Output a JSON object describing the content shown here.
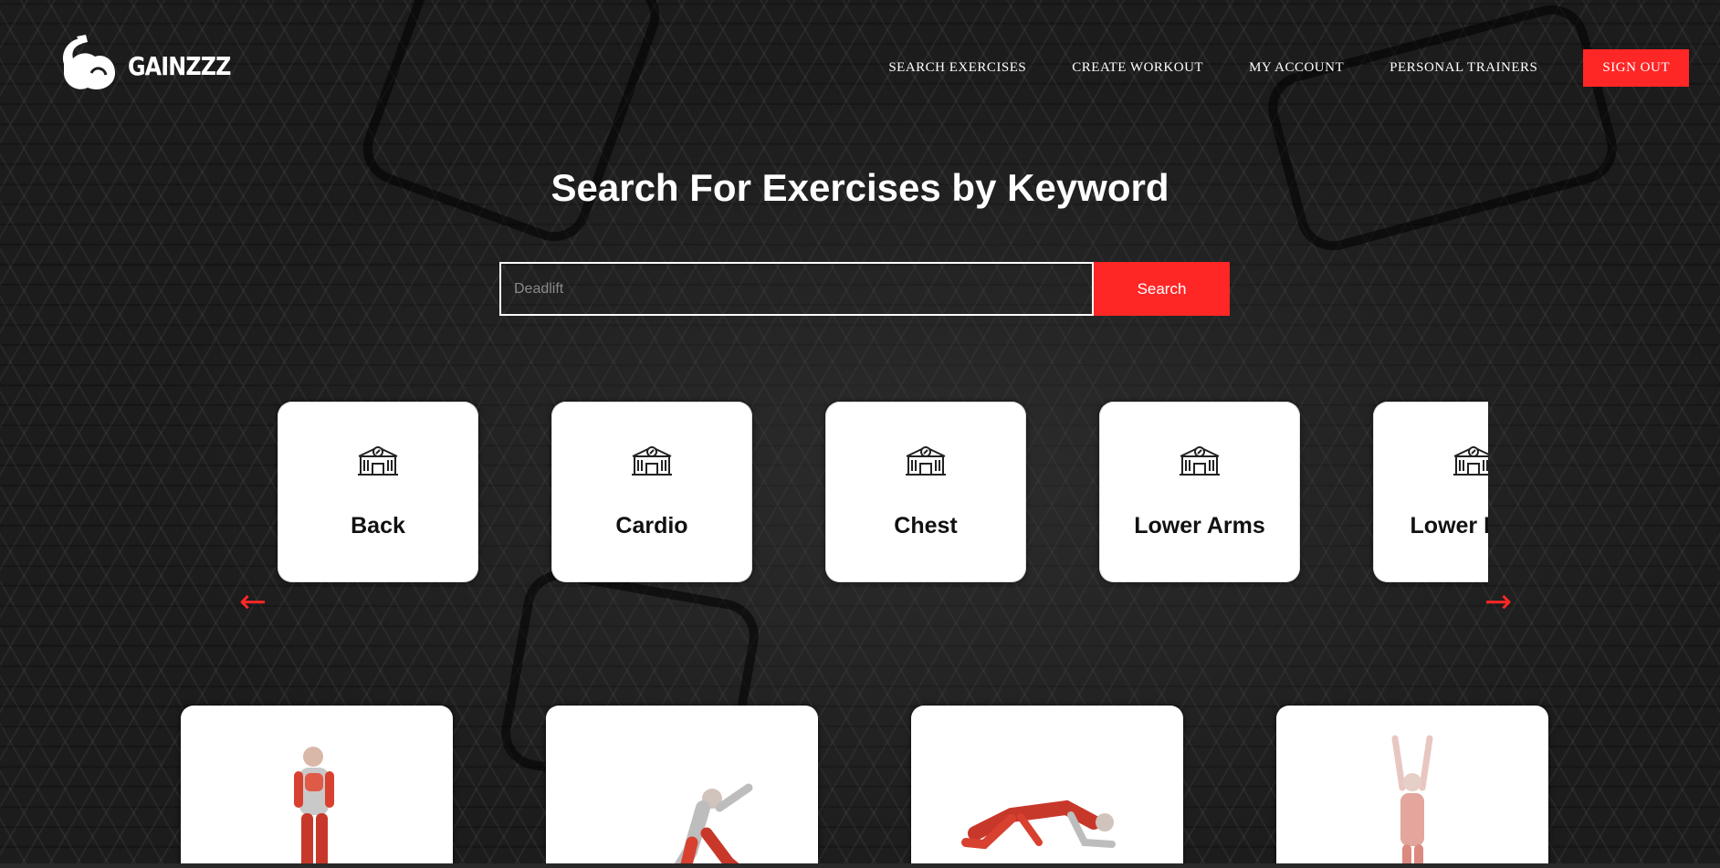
{
  "brand": {
    "name": "GAINZZZ"
  },
  "nav": {
    "items": [
      {
        "label": "SEARCH EXERCISES"
      },
      {
        "label": "CREATE WORKOUT"
      },
      {
        "label": "MY ACCOUNT"
      },
      {
        "label": "PERSONAL TRAINERS"
      }
    ],
    "signout_label": "SIGN OUT"
  },
  "hero": {
    "title": "Search For Exercises by Keyword"
  },
  "search": {
    "placeholder": "Deadlift",
    "button_label": "Search"
  },
  "categories": [
    {
      "label": "Back",
      "icon": "gym-building-icon"
    },
    {
      "label": "Cardio",
      "icon": "gym-building-icon"
    },
    {
      "label": "Chest",
      "icon": "gym-building-icon"
    },
    {
      "label": "Lower Arms",
      "icon": "gym-building-icon"
    },
    {
      "label": "Lower Legs",
      "icon": "gym-building-icon"
    }
  ],
  "carousel": {
    "prev_icon": "←",
    "next_icon": "→"
  },
  "exercises": [
    {
      "icon": "standing-muscle-figure"
    },
    {
      "icon": "lunge-muscle-figure"
    },
    {
      "icon": "crawl-muscle-figure"
    },
    {
      "icon": "arms-up-muscle-figure"
    }
  ],
  "colors": {
    "accent": "#ff2626",
    "background": "#1c1c1c",
    "card": "#ffffff"
  }
}
